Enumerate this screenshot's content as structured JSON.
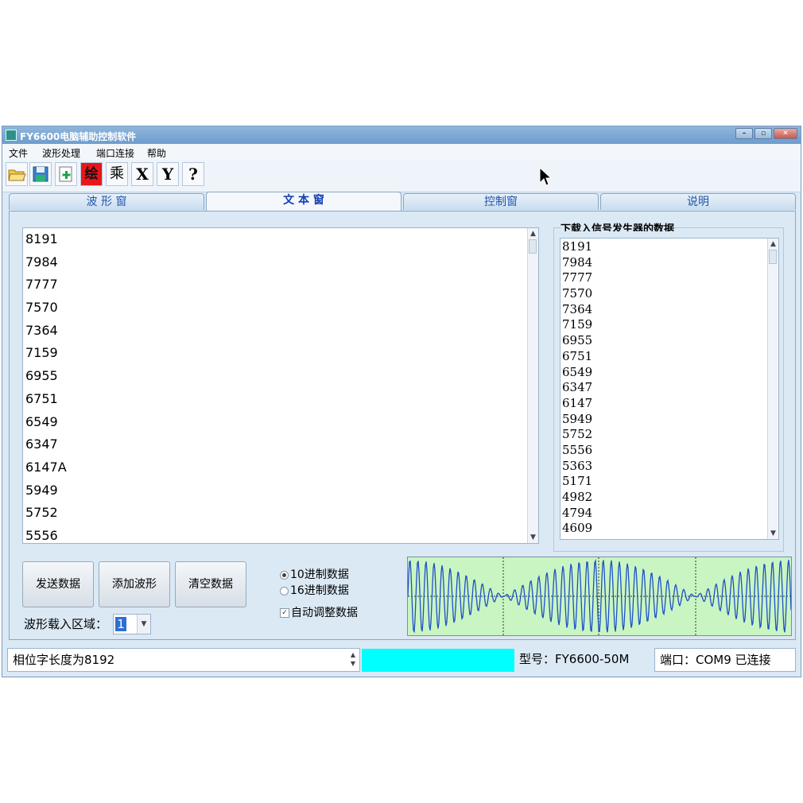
{
  "window": {
    "title": "FY6600电脑辅助控制软件",
    "controls": [
      "–",
      "▫",
      "✕"
    ]
  },
  "menu": [
    "文件",
    "波形处理",
    "端口连接",
    "帮助"
  ],
  "toolbar": {
    "icons": [
      "open-folder-icon",
      "save-disk-icon",
      "add-document-icon",
      "draw-icon",
      "multiply-icon",
      "x-axis-icon",
      "y-axis-icon",
      "help-icon"
    ],
    "draw_label": "绘",
    "multiply_label": "乘",
    "x_label": "X",
    "y_label": "Y",
    "help_label": "?"
  },
  "tabs": [
    {
      "label": "波 形 窗",
      "active": false
    },
    {
      "label": "文 本 窗",
      "active": true
    },
    {
      "label": "控制窗",
      "active": false
    },
    {
      "label": "说明",
      "active": false
    }
  ],
  "main_text": [
    "8191",
    "7984",
    "7777",
    "7570",
    "7364",
    "7159",
    "6955",
    "6751",
    "6549",
    "6347",
    "6147A",
    "5949",
    "5752",
    "5556"
  ],
  "download_group": {
    "title": "下载入信号发生器的数据",
    "values": [
      "8191",
      "7984",
      "7777",
      "7570",
      "7364",
      "7159",
      "6955",
      "6751",
      "6549",
      "6347",
      "6147",
      "5949",
      "5752",
      "5556",
      "5363",
      "5171",
      "4982",
      "4794",
      "4609"
    ]
  },
  "buttons": {
    "send": "发送数据",
    "add_wave": "添加波形",
    "clear": "清空数据"
  },
  "options": {
    "decimal": "10进制数据",
    "hex": "16进制数据",
    "auto_adjust": "自动调整数据",
    "selected": "decimal",
    "auto_adjust_checked": true
  },
  "load_area": {
    "label": "波形载入区域：",
    "value": "1"
  },
  "status": {
    "phase_text": "相位字长度为8192",
    "model": "型号：FY6600-50M",
    "port": "端口：COM9 已连接",
    "progress_color": "#00ffff"
  },
  "colors": {
    "wave_bg": "#c9f5c2",
    "wave_line": "#1f4fc8",
    "window_bg": "#dbe9f5",
    "tab_text": "#2255aa"
  }
}
